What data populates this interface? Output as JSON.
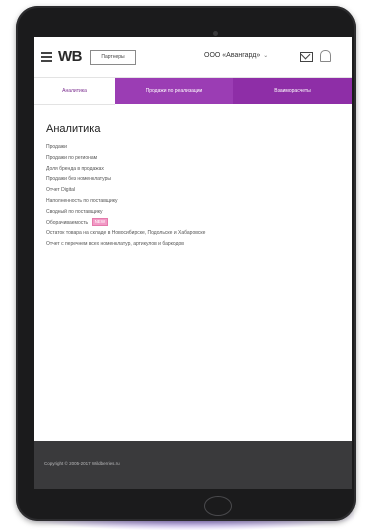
{
  "header": {
    "logo": "WB",
    "partner_button": "Партнеры",
    "organization": "ООО «Авангард»",
    "organization_chevron": "⌄"
  },
  "tabs": [
    {
      "label": "Аналитика"
    },
    {
      "label": "Продажи по реализации"
    },
    {
      "label": "Взаиморасчеты"
    }
  ],
  "main": {
    "title": "Аналитика",
    "links": [
      "Продажи",
      "Продажи по регионам",
      "Доля бренда в продажах",
      "Продажи без номенклатуры",
      "Отчет Digital",
      "Наполненность по поставщику",
      "Сводный по поставщику",
      "Оборачиваемость",
      "Остаток товара на складе в Новосибирске, Подольске и Хабаровске",
      "Отчет с перечнем всех номенклатур, артикулов и баркодов"
    ],
    "badge": "NEW"
  },
  "footer": {
    "copyright": "Copyright © 2005-2017 Wildberries.ru"
  },
  "colors": {
    "accent": "#9b3db4",
    "accent_dark": "#8e2ea7",
    "footer_bg": "#3a3a3c",
    "badge_bg": "#f29ac6"
  },
  "icons": {
    "menu": "hamburger-menu-icon",
    "mail": "mail-icon",
    "notifications": "bell-icon"
  }
}
